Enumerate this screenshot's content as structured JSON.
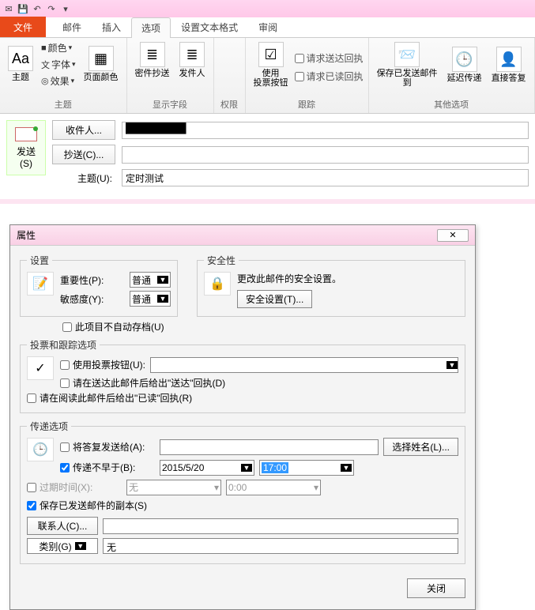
{
  "tabs": {
    "file": "文件",
    "mail": "邮件",
    "insert": "插入",
    "options": "选项",
    "format": "设置文本格式",
    "review": "审阅"
  },
  "ribbon": {
    "theme": {
      "theme": "主题",
      "color": "颜色",
      "font": "字体",
      "effect": "效果",
      "pageColor": "页面颜色",
      "group": "主题"
    },
    "fields": {
      "bcc": "密件抄送",
      "from": "发件人",
      "group": "显示字段"
    },
    "permission": {
      "group": "权限"
    },
    "track": {
      "voting": "使用\n投票按钮",
      "requestDelivery": "请求送达回执",
      "requestRead": "请求已读回执",
      "group": "跟踪"
    },
    "other": {
      "saveSent": "保存已发送邮件\n到",
      "delay": "延迟传递",
      "direct": "直接答复",
      "group": "其他选项"
    }
  },
  "compose": {
    "send": "发送\n(S)",
    "to": "收件人...",
    "cc": "抄送(C)...",
    "subjectLabel": "主题(U):",
    "subjectValue": "定时测试"
  },
  "dialog": {
    "title": "属性",
    "settings": {
      "legend": "设置",
      "importanceLabel": "重要性(P):",
      "importanceValue": "普通",
      "sensitivityLabel": "敏感度(Y):",
      "sensitivityValue": "普通",
      "noAutoArchive": "此项目不自动存档(U)"
    },
    "security": {
      "legend": "安全性",
      "text": "更改此邮件的安全设置。",
      "button": "安全设置(T)..."
    },
    "voting": {
      "legend": "投票和跟踪选项",
      "useVoting": "使用投票按钮(U):",
      "deliveryReceipt": "请在送达此邮件后给出\"送达\"回执(D)",
      "readReceipt": "请在阅读此邮件后给出\"已读\"回执(R)"
    },
    "delivery": {
      "legend": "传递选项",
      "replyTo": "将答复发送给(A):",
      "selectNames": "选择姓名(L)...",
      "notBefore": "传递不早于(B):",
      "notBeforeDate": "2015/5/20",
      "notBeforeTime": "17:00",
      "expires": "过期时间(X):",
      "expiresDate": "无",
      "expiresTime": "0:00",
      "saveCopy": "保存已发送邮件的副本(S)",
      "contacts": "联系人(C)...",
      "categories": "类别(G)",
      "categoriesValue": "无"
    },
    "close": "关闭"
  }
}
